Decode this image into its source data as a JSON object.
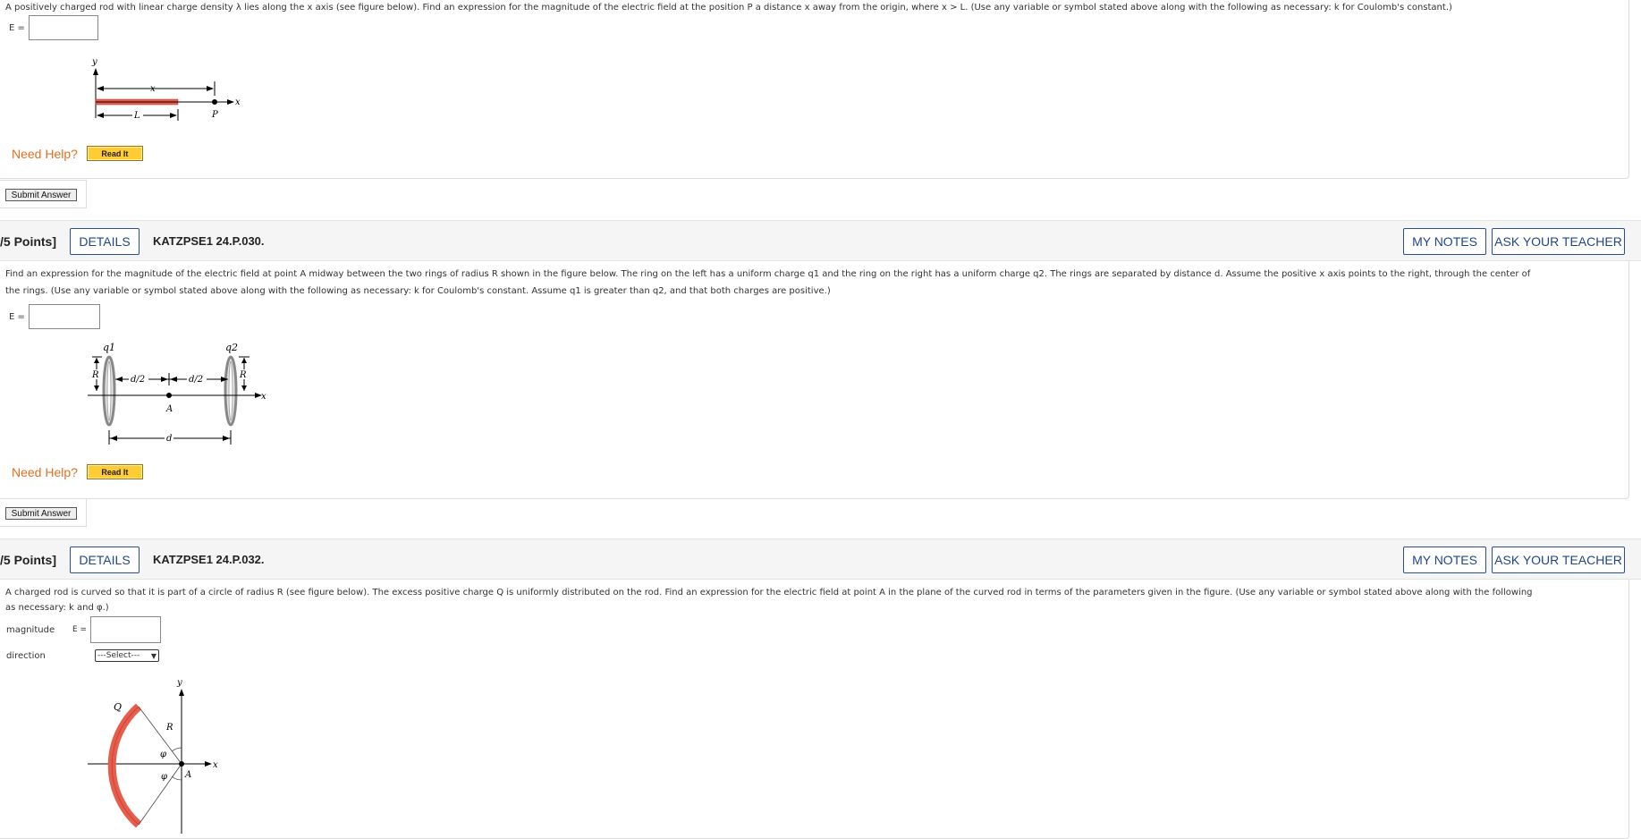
{
  "q1": {
    "text": "A positively charged rod with linear charge density λ lies along the x axis (see figure below). Find an expression for the magnitude of the electric field at the position P a distance x away from the origin, where  x > L.  (Use any variable or symbol stated above along with the following as necessary: k for Coulomb's constant.)",
    "answer_label": "E =",
    "figure": {
      "y": "y",
      "x_top": "x",
      "x_axis": "x",
      "L": "L",
      "P": "P"
    },
    "need_help": "Need Help?",
    "read_it": "Read It",
    "submit": "Submit Answer"
  },
  "q2": {
    "points": "/5 Points]",
    "details": "DETAILS",
    "id": "KATZPSE1 24.P.030.",
    "my_notes": "MY NOTES",
    "ask_teacher": "ASK YOUR TEACHER",
    "text_line1": "Find an expression for the magnitude of the electric field at point A midway between the two rings of radius R shown in the figure below. The ring on the left has a uniform charge q1 and the ring on the right has a uniform charge q2. The rings are separated by distance d. Assume the positive x axis points to the right, through the center of",
    "text_line2": "the rings. (Use any variable or symbol stated above along with the following as necessary: k for Coulomb's constant. Assume q1 is greater than q2, and that both charges are positive.)",
    "answer_label": "E =",
    "figure": {
      "q1": "q1",
      "q2": "q2",
      "R_left": "R",
      "R_right": "R",
      "d2_left": "d/2",
      "d2_right": "d/2",
      "A": "A",
      "d": "d",
      "x": "x"
    },
    "need_help": "Need Help?",
    "read_it": "Read It",
    "submit": "Submit Answer"
  },
  "q3": {
    "points": "/5 Points]",
    "details": "DETAILS",
    "id": "KATZPSE1 24.P.032.",
    "my_notes": "MY NOTES",
    "ask_teacher": "ASK YOUR TEACHER",
    "text_line1": "A charged rod is curved so that it is part of a circle of radius R (see figure below). The excess positive charge Q is uniformly distributed on the rod. Find an expression for the electric field at point A in the plane of the curved rod in terms of the parameters given in the figure. (Use any variable or symbol stated above along with the following",
    "text_line2": "as necessary: k and φ.)",
    "magnitude_label": "magnitude",
    "answer_label": "E =",
    "direction_label": "direction",
    "direction_select": "---Select---",
    "figure": {
      "Q": "Q",
      "R": "R",
      "phi_top": "φ",
      "phi_bottom": "φ",
      "y": "y",
      "x": "x",
      "A": "A"
    }
  }
}
